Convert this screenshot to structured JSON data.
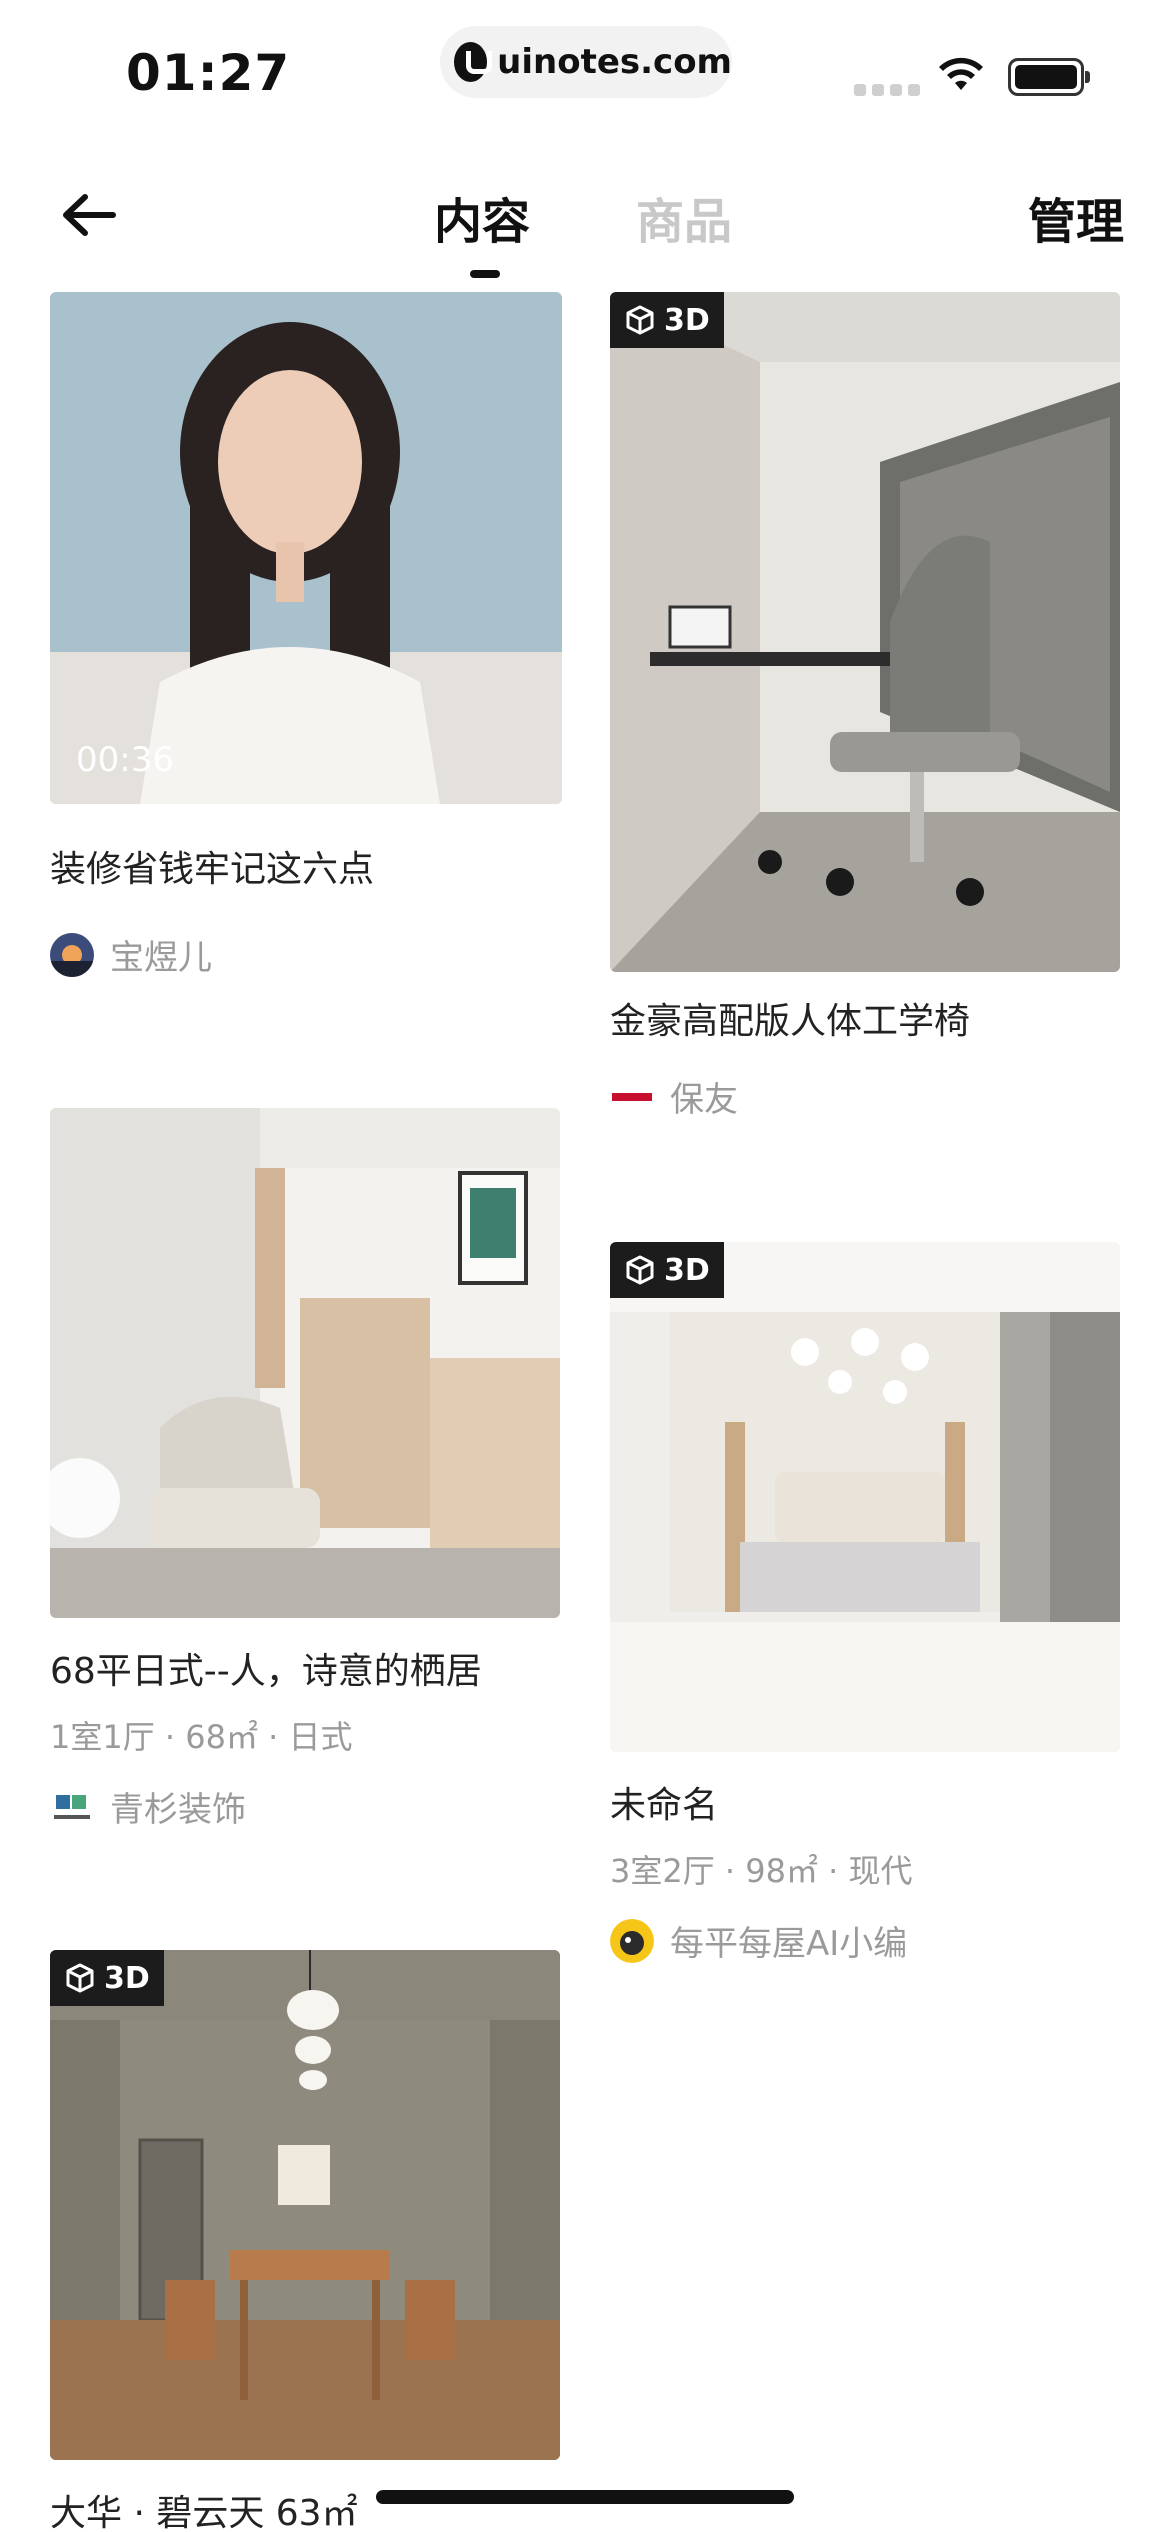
{
  "status_bar": {
    "time": "01:27",
    "url": "uinotes.com",
    "icons": [
      "cellular-signal-icon",
      "wifi-icon",
      "battery-icon"
    ]
  },
  "nav": {
    "back_icon": "arrow-left-icon",
    "tabs": [
      {
        "label": "内容",
        "active": true
      },
      {
        "label": "商品",
        "active": false
      }
    ],
    "manage_label": "管理"
  },
  "badge_label": "3D",
  "cards": [
    {
      "title": "装修省钱牢记这六点",
      "duration": "00:36",
      "author": "宝煜儿"
    },
    {
      "title": "金豪高配版人体工学椅",
      "author": "保友"
    },
    {
      "title": "68平日式--人，诗意的栖居",
      "meta": "1室1厅 · 68㎡ · 日式",
      "author": "青杉装饰"
    },
    {
      "title": "未命名",
      "meta": "3室2厅 · 98㎡ · 现代",
      "author": "每平每屋AI小编"
    },
    {
      "title": "大华 · 碧云天 63㎡"
    }
  ],
  "colors": {
    "primary_text": "#111111",
    "inactive_tab": "#c8c8c8",
    "meta_text": "#9a9a9a",
    "badge_bg": "#1c1c1c"
  }
}
